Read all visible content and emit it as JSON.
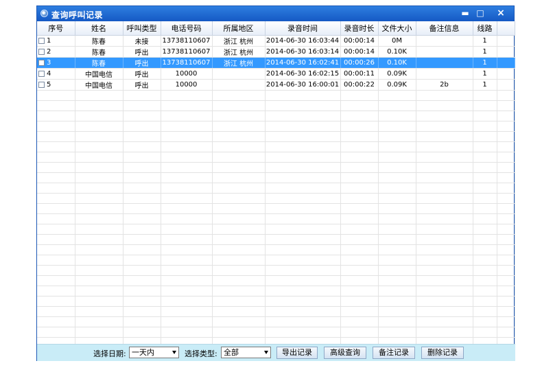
{
  "window": {
    "title": "查询呼叫记录",
    "minimize": "▬",
    "maximize": "□",
    "close": "×"
  },
  "columns": [
    "序号",
    "姓名",
    "呼叫类型",
    "电话号码",
    "所属地区",
    "录音时间",
    "录音时长",
    "文件大小",
    "备注信息",
    "线路"
  ],
  "rows": [
    {
      "no": "1",
      "name": "陈春",
      "type": "未接",
      "phone": "13738110607",
      "region": "浙江  杭州",
      "time": "2014-06-30 16:03:44",
      "duration": "00:00:14",
      "size": "0M",
      "note": "",
      "line": "1"
    },
    {
      "no": "2",
      "name": "陈春",
      "type": "呼出",
      "phone": "13738110607",
      "region": "浙江  杭州",
      "time": "2014-06-30 16:03:14",
      "duration": "00:00:14",
      "size": "0.10K",
      "note": "",
      "line": "1"
    },
    {
      "no": "3",
      "name": "陈春",
      "type": "呼出",
      "phone": "13738110607",
      "region": "浙江  杭州",
      "time": "2014-06-30 16:02:41",
      "duration": "00:00:26",
      "size": "0.10K",
      "note": "",
      "line": "1"
    },
    {
      "no": "4",
      "name": "中国电信",
      "type": "呼出",
      "phone": "10000",
      "region": "",
      "time": "2014-06-30 16:02:15",
      "duration": "00:00:11",
      "size": "0.09K",
      "note": "",
      "line": "1"
    },
    {
      "no": "5",
      "name": "中国电信",
      "type": "呼出",
      "phone": "10000",
      "region": "",
      "time": "2014-06-30 16:00:01",
      "duration": "00:00:22",
      "size": "0.09K",
      "note": "2b",
      "line": "1"
    }
  ],
  "toolbar": {
    "date_label": "选择日期:",
    "date_value": "一天内",
    "type_label": "选择类型:",
    "type_value": "全部",
    "export": "导出记录",
    "advanced": "高级查询",
    "note": "备注记录",
    "delete": "删除记录"
  },
  "colors": {
    "titlebar": "#1f6bd6",
    "selection": "#3399ff",
    "bottombar": "#c9ecf7"
  }
}
